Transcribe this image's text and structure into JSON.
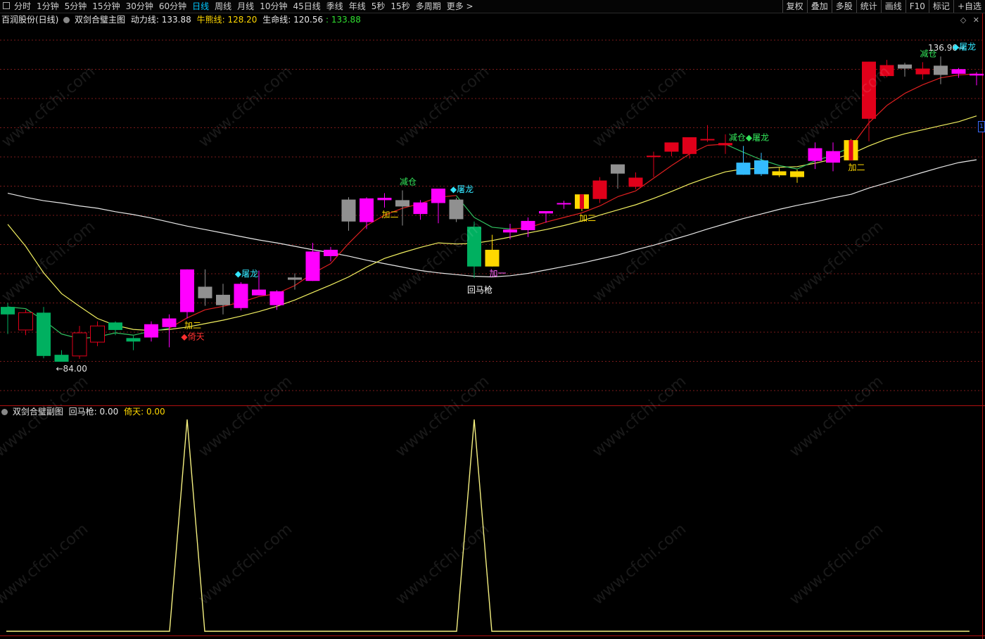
{
  "toolbar": {
    "periods": [
      "分时",
      "1分钟",
      "5分钟",
      "15分钟",
      "30分钟",
      "60分钟",
      "日线",
      "周线",
      "月线",
      "10分钟",
      "45日线",
      "季线",
      "年线",
      "5秒",
      "15秒",
      "多周期",
      "更多 >"
    ],
    "active": "日线",
    "right": [
      "复权",
      "叠加",
      "多股",
      "统计",
      "画线",
      "F10",
      "标记",
      "+自选"
    ]
  },
  "main_info": {
    "stock": "百润股份(日线)",
    "indicator": "双剑合璧主图",
    "power_label": "动力线:",
    "power_value": "133.88",
    "bull_label": "牛熊线:",
    "bull_value": "128.20",
    "life_label": "生命线:",
    "life_value": "120.56",
    "extra_value": ": 133.88"
  },
  "sub_info": {
    "indicator": "双剑合璧副图",
    "huima_label": "回马枪:",
    "huima_value": "0.00",
    "yitian_label": "倚天:",
    "yitian_value": "0.00"
  },
  "side_tag": "1",
  "colors": {
    "up": "#ff00ff",
    "down": "#00b060",
    "red": "#e0001a",
    "gray": "#909090",
    "yellow": "#ffd800",
    "cyan": "#33bbff",
    "grid": "#7a1a1a",
    "power": "#e02020",
    "bull": "#f2f060",
    "life": "#e8e8e8",
    "sub": "#f5f080"
  },
  "chart_data": {
    "type": "candlestick",
    "title": "百润股份(日线)",
    "price_min": 84.0,
    "price_max": 136.9,
    "candles": [
      {
        "o": 93.5,
        "h": 94.2,
        "l": 88.8,
        "c": 92.2,
        "t": "green"
      },
      {
        "o": 92.5,
        "h": 93.0,
        "l": 88.6,
        "c": 89.5,
        "t": "hollow"
      },
      {
        "o": 92.5,
        "h": 93.5,
        "l": 84.6,
        "c": 85.0,
        "t": "green"
      },
      {
        "o": 85.2,
        "h": 86.0,
        "l": 84.0,
        "c": 84.0,
        "t": "green"
      },
      {
        "o": 85.0,
        "h": 90.2,
        "l": 84.5,
        "c": 89.0,
        "t": "hollow"
      },
      {
        "o": 87.4,
        "h": 91.0,
        "l": 86.7,
        "c": 90.2,
        "t": "hollow"
      },
      {
        "o": 89.5,
        "h": 91.0,
        "l": 88.6,
        "c": 90.8,
        "t": "green"
      },
      {
        "o": 87.5,
        "h": 88.5,
        "l": 86.0,
        "c": 88.1,
        "t": "green"
      },
      {
        "o": 88.2,
        "h": 91.0,
        "l": 87.5,
        "c": 90.5,
        "t": "up"
      },
      {
        "o": 90.0,
        "h": 92.2,
        "l": 86.5,
        "c": 91.5,
        "t": "up"
      },
      {
        "o": 92.6,
        "h": 100.0,
        "l": 91.5,
        "c": 100.0,
        "t": "up"
      },
      {
        "o": 95.0,
        "h": 100.0,
        "l": 93.7,
        "c": 97.0,
        "t": "gray"
      },
      {
        "o": 93.8,
        "h": 97.5,
        "l": 92.2,
        "c": 95.6,
        "t": "gray"
      },
      {
        "o": 93.3,
        "h": 97.8,
        "l": 92.9,
        "c": 97.5,
        "t": "up"
      },
      {
        "o": 95.5,
        "h": 99.8,
        "l": 95.5,
        "c": 96.5,
        "t": "up"
      },
      {
        "o": 93.8,
        "h": 96.4,
        "l": 93.0,
        "c": 96.2,
        "t": "up"
      },
      {
        "o": 98.2,
        "h": 99.3,
        "l": 96.5,
        "c": 98.6,
        "t": "gray"
      },
      {
        "o": 98.0,
        "h": 104.6,
        "l": 98.0,
        "c": 103.1,
        "t": "up"
      },
      {
        "o": 102.3,
        "h": 103.9,
        "l": 101.4,
        "c": 103.4,
        "t": "up"
      },
      {
        "o": 108.3,
        "h": 112.5,
        "l": 106.7,
        "c": 112.1,
        "t": "gray"
      },
      {
        "o": 108.2,
        "h": 112.5,
        "l": 107.0,
        "c": 112.3,
        "t": "up"
      },
      {
        "o": 112.0,
        "h": 113.2,
        "l": 110.7,
        "c": 112.4,
        "t": "up"
      },
      {
        "o": 110.9,
        "h": 113.7,
        "l": 107.6,
        "c": 112.0,
        "t": "gray"
      },
      {
        "o": 109.6,
        "h": 112.0,
        "l": 108.6,
        "c": 111.6,
        "t": "up"
      },
      {
        "o": 111.5,
        "h": 113.2,
        "l": 108.0,
        "c": 114.0,
        "t": "up"
      },
      {
        "o": 108.7,
        "h": 112.4,
        "l": 108.2,
        "c": 112.1,
        "t": "gray"
      },
      {
        "o": 107.4,
        "h": 108.3,
        "l": 98.5,
        "c": 100.5,
        "t": "green"
      },
      {
        "o": 103.4,
        "h": 106.0,
        "l": 100.5,
        "c": 100.5,
        "t": "yellow"
      },
      {
        "o": 106.9,
        "h": 107.9,
        "l": 105.2,
        "c": 106.4,
        "t": "up"
      },
      {
        "o": 106.8,
        "h": 109.0,
        "l": 105.6,
        "c": 108.4,
        "t": "up"
      },
      {
        "o": 109.7,
        "h": 110.1,
        "l": 108.1,
        "c": 110.1,
        "t": "up"
      },
      {
        "o": 111.3,
        "h": 111.9,
        "l": 110.5,
        "c": 111.5,
        "t": "up"
      },
      {
        "o": 110.5,
        "h": 112.4,
        "l": 110.1,
        "c": 113.0,
        "t": "yellow"
      },
      {
        "o": 112.2,
        "h": 116.0,
        "l": 111.5,
        "c": 115.4,
        "t": "red"
      },
      {
        "o": 116.6,
        "h": 117.7,
        "l": 114.0,
        "c": 118.2,
        "t": "gray"
      },
      {
        "o": 115.9,
        "h": 116.8,
        "l": 113.9,
        "c": 114.3,
        "t": "red"
      },
      {
        "o": 119.7,
        "h": 120.4,
        "l": 116.0,
        "c": 119.7,
        "t": "red"
      },
      {
        "o": 120.4,
        "h": 121.3,
        "l": 119.6,
        "c": 122.0,
        "t": "red"
      },
      {
        "o": 120.0,
        "h": 122.8,
        "l": 119.2,
        "c": 122.9,
        "t": "red"
      },
      {
        "o": 122.6,
        "h": 125.0,
        "l": 122.1,
        "c": 122.4,
        "t": "red"
      },
      {
        "o": 121.5,
        "h": 123.4,
        "l": 120.0,
        "c": 121.9,
        "t": "red"
      },
      {
        "o": 116.4,
        "h": 121.4,
        "l": 116.4,
        "c": 118.5,
        "t": "cyan"
      },
      {
        "o": 116.5,
        "h": 120.2,
        "l": 116.2,
        "c": 118.9,
        "t": "cyan"
      },
      {
        "o": 116.3,
        "h": 117.6,
        "l": 116.0,
        "c": 117.0,
        "t": "yellow"
      },
      {
        "o": 116.0,
        "h": 117.3,
        "l": 115.0,
        "c": 117.0,
        "t": "yellow"
      },
      {
        "o": 118.8,
        "h": 122.0,
        "l": 117.4,
        "c": 121.0,
        "t": "up"
      },
      {
        "o": 118.5,
        "h": 122.0,
        "l": 117.0,
        "c": 120.5,
        "t": "up"
      },
      {
        "o": 118.9,
        "h": 122.6,
        "l": 118.9,
        "c": 122.4,
        "t": "yellow"
      },
      {
        "o": 126.1,
        "h": 136.0,
        "l": 122.2,
        "c": 136.0,
        "t": "red"
      },
      {
        "o": 133.5,
        "h": 136.3,
        "l": 133.3,
        "c": 135.4,
        "t": "red"
      },
      {
        "o": 134.8,
        "h": 135.8,
        "l": 133.4,
        "c": 135.5,
        "t": "gray"
      },
      {
        "o": 133.8,
        "h": 135.9,
        "l": 132.9,
        "c": 134.8,
        "t": "red"
      },
      {
        "o": 133.7,
        "h": 136.9,
        "l": 132.1,
        "c": 135.3,
        "t": "gray"
      },
      {
        "o": 133.9,
        "h": 134.9,
        "l": 133.2,
        "c": 134.7,
        "t": "up"
      },
      {
        "o": 133.6,
        "h": 134.2,
        "l": 131.9,
        "c": 133.9,
        "t": "up"
      }
    ],
    "life_line": [
      113.2,
      112.5,
      111.9,
      111.5,
      111.0,
      110.6,
      110.0,
      109.5,
      108.9,
      108.2,
      107.5,
      106.9,
      106.3,
      105.7,
      105.1,
      104.6,
      104.0,
      103.4,
      102.9,
      102.3,
      101.6,
      101.0,
      100.4,
      99.8,
      99.4,
      99.1,
      98.8,
      98.7,
      98.9,
      99.3,
      99.9,
      100.5,
      101.1,
      101.8,
      102.5,
      103.4,
      104.2,
      105.1,
      106.0,
      107.0,
      107.9,
      108.8,
      109.6,
      110.4,
      111.1,
      111.7,
      112.4,
      113.0,
      114.1,
      115.0,
      115.9,
      116.8,
      117.7,
      118.5,
      119.0
    ],
    "bull_line": [
      107.8,
      104.0,
      99.4,
      95.8,
      93.6,
      91.5,
      90.3,
      89.6,
      89.4,
      89.6,
      90.0,
      90.6,
      91.2,
      91.9,
      92.7,
      93.6,
      94.7,
      96.0,
      97.3,
      98.7,
      100.4,
      101.9,
      102.9,
      103.8,
      104.6,
      104.4,
      104.5,
      105.0,
      105.6,
      106.3,
      106.9,
      107.6,
      108.4,
      109.4,
      110.3,
      111.2,
      112.3,
      113.5,
      114.8,
      115.9,
      116.9,
      117.4,
      117.5,
      117.7,
      117.8,
      118.4,
      119.1,
      120.0,
      121.4,
      122.6,
      123.5,
      124.2,
      124.9,
      125.6,
      126.6
    ],
    "power_line": [
      93.5,
      93.2,
      91.2,
      88.8,
      88.0,
      88.3,
      89.0,
      88.6,
      89.3,
      89.8,
      91.6,
      93.0,
      93.6,
      94.3,
      95.3,
      95.8,
      97.2,
      99.3,
      101.0,
      104.5,
      107.6,
      109.4,
      110.6,
      111.4,
      112.5,
      112.8,
      109.0,
      107.3,
      107.0,
      107.2,
      108.2,
      109.0,
      109.8,
      111.0,
      112.6,
      113.6,
      115.8,
      118.0,
      120.0,
      121.5,
      121.7,
      120.3,
      119.0,
      118.0,
      117.4,
      118.8,
      119.8,
      121.2,
      125.4,
      128.4,
      130.5,
      132.0,
      133.2,
      133.7,
      133.88
    ],
    "power_red_ranges": [
      [
        9,
        25
      ],
      [
        28,
        40
      ],
      [
        47,
        54
      ]
    ],
    "annotations": [
      {
        "i": 3,
        "text": "←84.00",
        "color": "#e0e0e0",
        "pos": "below"
      },
      {
        "i": 10,
        "text": "加二",
        "color": "#ffd800",
        "pos": "below"
      },
      {
        "i": 10,
        "text": "◆倚天",
        "color": "#ff3030",
        "pos": "below2"
      },
      {
        "i": 13,
        "text": "◆屠龙",
        "color": "#33e6ff",
        "pos": "above"
      },
      {
        "i": 21,
        "text": "加二",
        "color": "#ffd800",
        "pos": "below"
      },
      {
        "i": 22,
        "text": "减仓",
        "color": "#33e65a",
        "pos": "above"
      },
      {
        "i": 25,
        "text": "◆屠龙",
        "color": "#33e6ff",
        "pos": "above"
      },
      {
        "i": 27,
        "text": "加一",
        "color": "#ff66ff",
        "pos": "below"
      },
      {
        "i": 26,
        "text": "回马枪",
        "color": "#ffffff",
        "pos": "below3"
      },
      {
        "i": 32,
        "text": "加二",
        "color": "#ffd800",
        "pos": "below"
      },
      {
        "i": 41,
        "text": "减仓◆屠龙",
        "color": "#33e65a",
        "pos": "above"
      },
      {
        "i": 47,
        "text": "加二",
        "color": "#ffd800",
        "pos": "below"
      },
      {
        "i": 51,
        "text": "减仓",
        "color": "#33e65a",
        "pos": "above"
      },
      {
        "i": 52,
        "text": "136.90→",
        "color": "#e0e0e0",
        "pos": "above"
      },
      {
        "i": 53,
        "text": "◆屠龙",
        "color": "#33e6ff",
        "pos": "above2"
      }
    ],
    "sub_spikes": [
      10,
      26
    ]
  }
}
